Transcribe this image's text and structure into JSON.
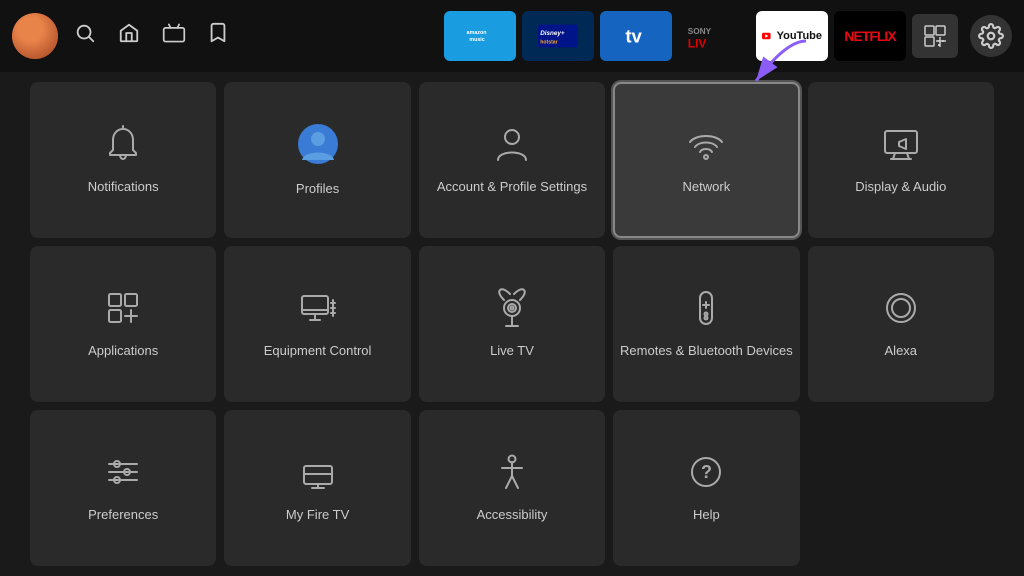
{
  "topbar": {
    "nav_items": [
      {
        "name": "search",
        "symbol": "🔍"
      },
      {
        "name": "home",
        "symbol": "⌂"
      },
      {
        "name": "live-tv",
        "symbol": "📺"
      },
      {
        "name": "watchlist",
        "symbol": "🔖"
      }
    ],
    "apps": [
      {
        "name": "amazon-music",
        "label": "amazon music",
        "style": "amazon_music"
      },
      {
        "name": "disney-hotstar",
        "label": "disney+ hotstar",
        "style": "disney"
      },
      {
        "name": "tv-app",
        "label": "tv",
        "style": "tv"
      },
      {
        "name": "sony-liv",
        "label": "SONY LIV",
        "style": "sony"
      },
      {
        "name": "youtube",
        "label": "YouTube",
        "style": "youtube"
      },
      {
        "name": "netflix",
        "label": "NETFLIX",
        "style": "netflix"
      },
      {
        "name": "apps-grid",
        "label": "⊞",
        "style": "grid"
      }
    ],
    "settings_label": "⚙"
  },
  "grid": {
    "items": [
      {
        "id": "notifications",
        "label": "Notifications",
        "icon": "bell"
      },
      {
        "id": "profiles",
        "label": "Profiles",
        "icon": "profile"
      },
      {
        "id": "account",
        "label": "Account & Profile Settings",
        "icon": "person"
      },
      {
        "id": "network",
        "label": "Network",
        "icon": "wifi",
        "highlighted": true
      },
      {
        "id": "display-audio",
        "label": "Display & Audio",
        "icon": "display"
      },
      {
        "id": "applications",
        "label": "Applications",
        "icon": "apps"
      },
      {
        "id": "equipment",
        "label": "Equipment Control",
        "icon": "monitor"
      },
      {
        "id": "live-tv",
        "label": "Live TV",
        "icon": "antenna"
      },
      {
        "id": "remotes",
        "label": "Remotes & Bluetooth Devices",
        "icon": "remote"
      },
      {
        "id": "alexa",
        "label": "Alexa",
        "icon": "alexa"
      },
      {
        "id": "preferences",
        "label": "Preferences",
        "icon": "sliders"
      },
      {
        "id": "my-fire-tv",
        "label": "My Fire TV",
        "icon": "firetv"
      },
      {
        "id": "accessibility",
        "label": "Accessibility",
        "icon": "accessibility"
      },
      {
        "id": "help",
        "label": "Help",
        "icon": "help"
      }
    ]
  }
}
